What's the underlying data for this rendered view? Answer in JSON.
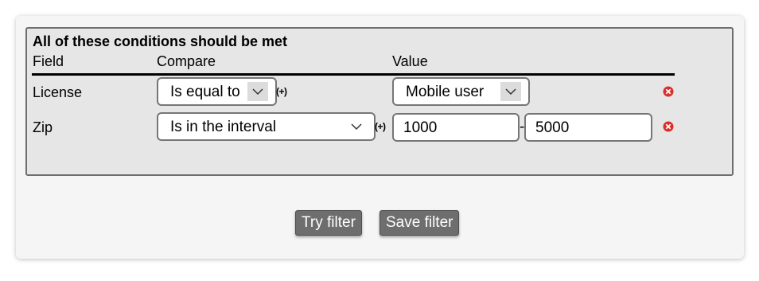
{
  "panel": {
    "title": "All of these conditions should be met",
    "headers": {
      "field": "Field",
      "compare": "Compare",
      "value": "Value"
    }
  },
  "rows": [
    {
      "field": "License",
      "compare": "Is equal to",
      "value_select": "Mobile user",
      "add_icon": "(+)",
      "remove_icon": "remove-icon"
    },
    {
      "field": "Zip",
      "compare": "Is in the interval",
      "value_from": "1000",
      "value_to": "5000",
      "separator": "-",
      "add_icon": "(+)",
      "remove_icon": "remove-icon"
    }
  ],
  "buttons": {
    "try": "Try filter",
    "save": "Save filter"
  },
  "colors": {
    "remove_icon": "#d9302c",
    "button_bg": "#6e6e6e",
    "panel_bg": "#e6e6e6"
  }
}
